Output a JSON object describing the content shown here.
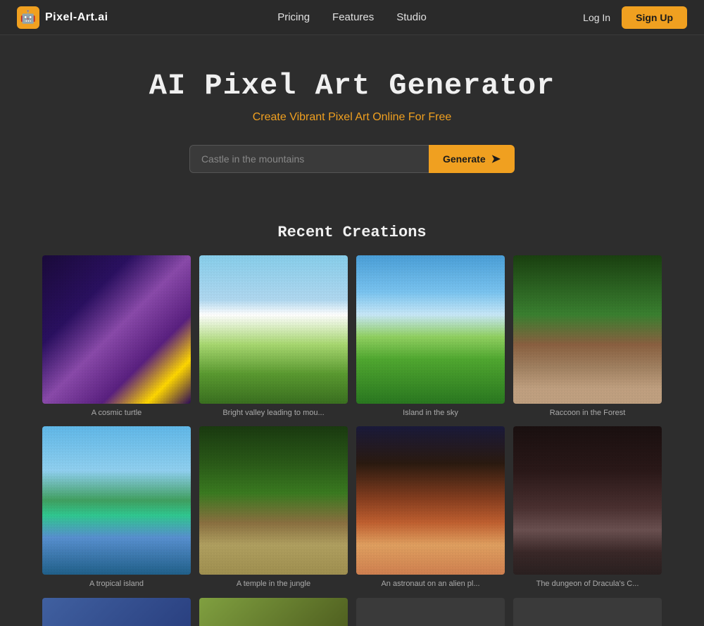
{
  "brand": {
    "logo_icon": "🤖",
    "logo_text": "Pixel-Art.ai"
  },
  "nav": {
    "links": [
      {
        "id": "pricing",
        "label": "Pricing"
      },
      {
        "id": "features",
        "label": "Features"
      },
      {
        "id": "studio",
        "label": "Studio"
      }
    ],
    "login_label": "Log In",
    "signup_label": "Sign Up"
  },
  "hero": {
    "title": "AI Pixel Art Generator",
    "subtitle": "Create Vibrant Pixel Art Online For Free",
    "input_placeholder": "Castle in the mountains",
    "generate_label": "Generate",
    "arrow": "➤"
  },
  "recent": {
    "section_title": "Recent Creations",
    "items": [
      {
        "id": "cosmic-turtle",
        "caption": "A cosmic turtle",
        "img_class": "img-cosmic-turtle"
      },
      {
        "id": "bright-valley",
        "caption": "Bright valley leading to mou...",
        "img_class": "img-bright-valley"
      },
      {
        "id": "island-sky",
        "caption": "Island in the sky",
        "img_class": "img-island-sky"
      },
      {
        "id": "raccoon-forest",
        "caption": "Raccoon in the Forest",
        "img_class": "img-raccoon-forest"
      },
      {
        "id": "tropical-island",
        "caption": "A tropical island",
        "img_class": "img-tropical-island"
      },
      {
        "id": "temple-jungle",
        "caption": "A temple in the jungle",
        "img_class": "img-temple-jungle"
      },
      {
        "id": "astronaut",
        "caption": "An astronaut on an alien pl...",
        "img_class": "img-astronaut"
      },
      {
        "id": "dungeon",
        "caption": "The dungeon of Dracula's C...",
        "img_class": "img-dungeon"
      }
    ]
  },
  "colors": {
    "accent": "#f0a020",
    "background": "#2d2d2d",
    "text_primary": "#f0f0f0",
    "text_secondary": "#aaaaaa"
  }
}
